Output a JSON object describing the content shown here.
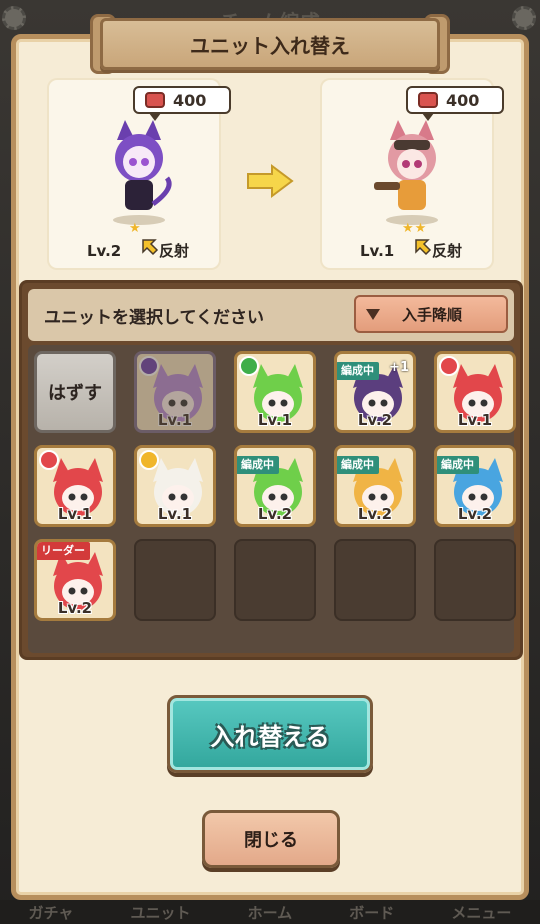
{
  "header": {
    "background_title": "チーム編成"
  },
  "dialog": {
    "title": "ユニット入れ替え",
    "current_unit": {
      "cost": "400",
      "level": "Lv.2",
      "skill": "反射",
      "stars": "★"
    },
    "new_unit": {
      "cost": "400",
      "level": "Lv.1",
      "skill": "反射",
      "stars": "★★"
    }
  },
  "selector": {
    "prompt": "ユニットを選択してください",
    "sort_label": "入手降順",
    "remove_label": "はずす",
    "units": [
      {
        "level": "Lv.1",
        "element": "dark",
        "tag": "",
        "color": "#b68ad6",
        "selected": true
      },
      {
        "level": "Lv.1",
        "element": "grass",
        "tag": "",
        "color": "#6fcf4a"
      },
      {
        "level": "Lv.2",
        "element": "",
        "tag": "編成中",
        "plus": "+1",
        "color": "#5b3e7e"
      },
      {
        "level": "Lv.1",
        "element": "fire",
        "tag": "",
        "color": "#e2474b"
      },
      {
        "level": "Lv.1",
        "element": "fire",
        "tag": "",
        "color": "#e2474b"
      },
      {
        "level": "Lv.1",
        "element": "light",
        "tag": "",
        "color": "#f4f1ea"
      },
      {
        "level": "Lv.2",
        "element": "",
        "tag": "編成中",
        "color": "#6fcf4a"
      },
      {
        "level": "Lv.2",
        "element": "",
        "tag": "編成中",
        "color": "#f0b445"
      },
      {
        "level": "Lv.2",
        "element": "",
        "tag": "編成中",
        "color": "#49a5e0"
      },
      {
        "level": "Lv.2",
        "element": "",
        "tag": "リーダー",
        "color": "#e2474b"
      }
    ]
  },
  "buttons": {
    "swap": "入れ替える",
    "close": "閉じる"
  },
  "bottom_nav": [
    "ガチャ",
    "ユニット",
    "ホーム",
    "ボード",
    "メニュー"
  ],
  "colors": {
    "accent_teal": "#32a69c",
    "panel_brown": "#6b4a2e",
    "paper": "#f6ecd6"
  }
}
